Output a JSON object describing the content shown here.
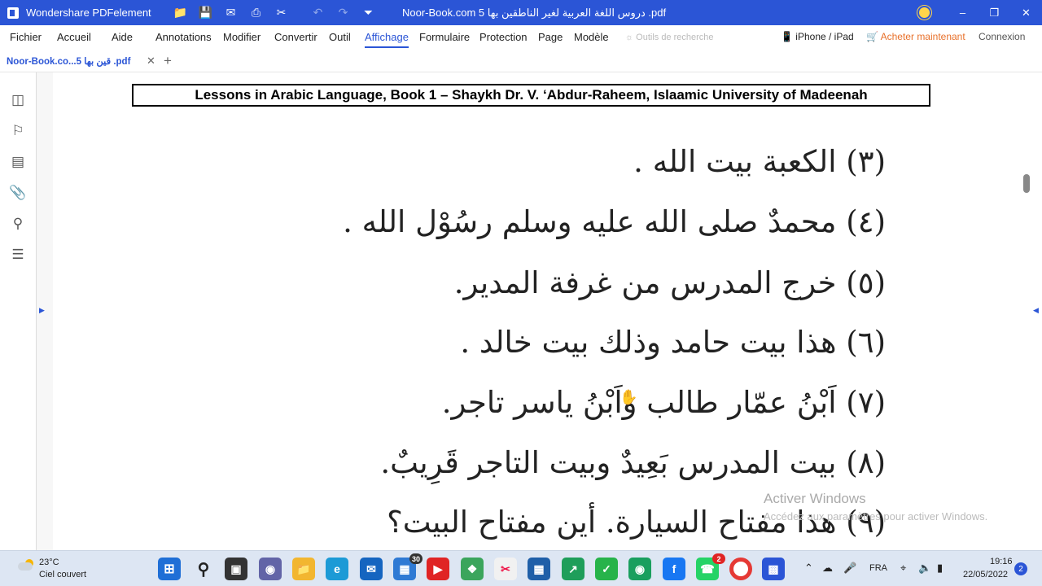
{
  "app": {
    "name": "Wondershare PDFelement",
    "document_title": "Noor-Book.com  دروس اللغة العربية لغير الناطقين بها 5 .pdf",
    "colors": {
      "accent": "#2b55d6",
      "titlebar": "#2b55d6",
      "taskbar": "#dde6f3"
    }
  },
  "toolbar_icons": [
    "folder-icon",
    "save-icon",
    "mail-icon",
    "print-icon",
    "scissors-icon",
    "undo-icon",
    "redo-icon",
    "dropdown-icon"
  ],
  "menu": {
    "items": [
      "Fichier",
      "Accueil",
      "Aide",
      "Annotations",
      "Modifier",
      "Convertir",
      "Outil",
      "Affichage",
      "Formulaire",
      "Protection",
      "Page",
      "Modèle"
    ],
    "active": "Affichage",
    "search_tools": "Outils de recherche",
    "device": "iPhone / iPad",
    "buy": "Acheter maintenant",
    "login": "Connexion"
  },
  "tab": {
    "label": "Noor-Book.co...5 قين بها .pdf"
  },
  "document": {
    "header": "Lessons in Arabic Language, Book 1 – Shaykh Dr. V. ‘Abdur-Raheem, Islaamic University of Madeenah",
    "lines": [
      "(٣) الكعبة بيت الله .",
      "(٤) محمدٌ صلى الله عليه وسلم رسُوْل الله .",
      "(٥) خرج المدرس من غرفة المدير.",
      "(٦) هذا بيت حامد وذلك بيت خالد .",
      "(٧) اَبْنُ عمّار طالب واَبْنُ ياسر تاجر.",
      "(٨) بيت المدرس بَعِيدٌ وبيت التاجر قَرِيبٌ.",
      "(٩) هذا مفتاح السيارة.  أين مفتاح البيت؟"
    ]
  },
  "watermark": {
    "title": "Activer Windows",
    "subtitle": "Accédez aux paramètres pour activer Windows."
  },
  "taskbar": {
    "weather_temp": "23°C",
    "weather_desc": "Ciel couvert",
    "badge_store": "30",
    "badge_whatsapp": "2",
    "lang": "FRA",
    "time": "19:16",
    "date": "22/05/2022",
    "notifications": "2"
  }
}
